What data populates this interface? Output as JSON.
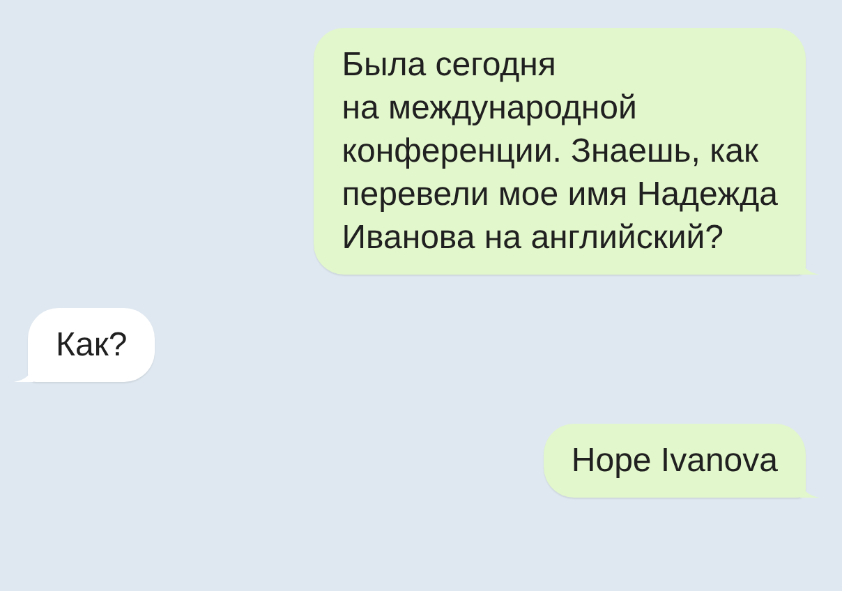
{
  "messages": [
    {
      "kind": "outgoing",
      "text": "Была сегодня\nна международной\nконференции. Знаешь, как\nперевели мое имя Надежда\nИванова на английский?"
    },
    {
      "kind": "incoming",
      "text": "Как?"
    },
    {
      "kind": "outgoing",
      "text": "Hope Ivanova"
    }
  ]
}
